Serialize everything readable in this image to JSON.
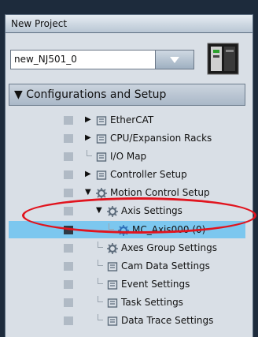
{
  "panel": {
    "title": "New Project"
  },
  "project_select": {
    "value": "new_NJ501_0"
  },
  "section": {
    "label": "▼ Configurations and Setup"
  },
  "tree": {
    "items": [
      {
        "label": "EtherCAT",
        "arrow": "▶",
        "icon": "ethercat-icon"
      },
      {
        "label": "CPU/Expansion Racks",
        "arrow": "▶",
        "icon": "cpu-rack-icon"
      },
      {
        "label": "I/O Map",
        "arrow": "",
        "icon": "io-map-icon"
      },
      {
        "label": "Controller Setup",
        "arrow": "▶",
        "icon": "controller-setup-icon"
      },
      {
        "label": "Motion Control Setup",
        "arrow": "▼",
        "icon": "gear-icon"
      },
      {
        "label": "Axis Settings",
        "arrow": "▼",
        "icon": "gear-icon"
      },
      {
        "label": "MC_Axis000 (0)",
        "arrow": "",
        "icon": "axis-icon",
        "selected": true
      },
      {
        "label": "Axes Group Settings",
        "arrow": "",
        "icon": "gear-icon"
      },
      {
        "label": "Cam Data Settings",
        "arrow": "",
        "icon": "cam-icon"
      },
      {
        "label": "Event Settings",
        "arrow": "",
        "icon": "flag-icon"
      },
      {
        "label": "Task Settings",
        "arrow": "",
        "icon": "task-icon"
      },
      {
        "label": "Data Trace Settings",
        "arrow": "",
        "icon": "trace-icon"
      }
    ]
  },
  "colors": {
    "selection": "#7cc7ef",
    "annotation": "#e1141e",
    "background": "#1d2b3c"
  }
}
